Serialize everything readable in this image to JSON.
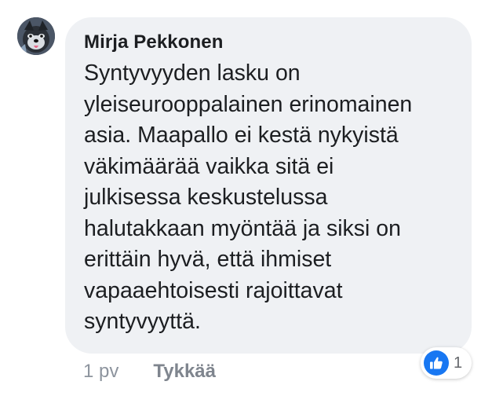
{
  "comment": {
    "author": "Mirja Pekkonen",
    "lines": [
      "Syntyvyyden lasku on",
      "yleiseurooppalainen erinomainen",
      "asia. Maapallo ei kestä nykyistä",
      "väkimäärää vaikka sitä ei",
      "julkisessa keskustelussa",
      "halutakkaan myöntää ja siksi on",
      "erittäin hyvä, että ihmiset",
      "vapaaehtoisesti rajoittavat",
      "syntyvyyttä."
    ],
    "timestamp": "1 pv",
    "like_label": "Tykkää",
    "reaction_count": "1",
    "reaction_icon": "thumbs-up-icon",
    "colors": {
      "bubble": "#eff1f4",
      "like_badge": "#1877f2",
      "meta_text": "#8d949e"
    }
  }
}
